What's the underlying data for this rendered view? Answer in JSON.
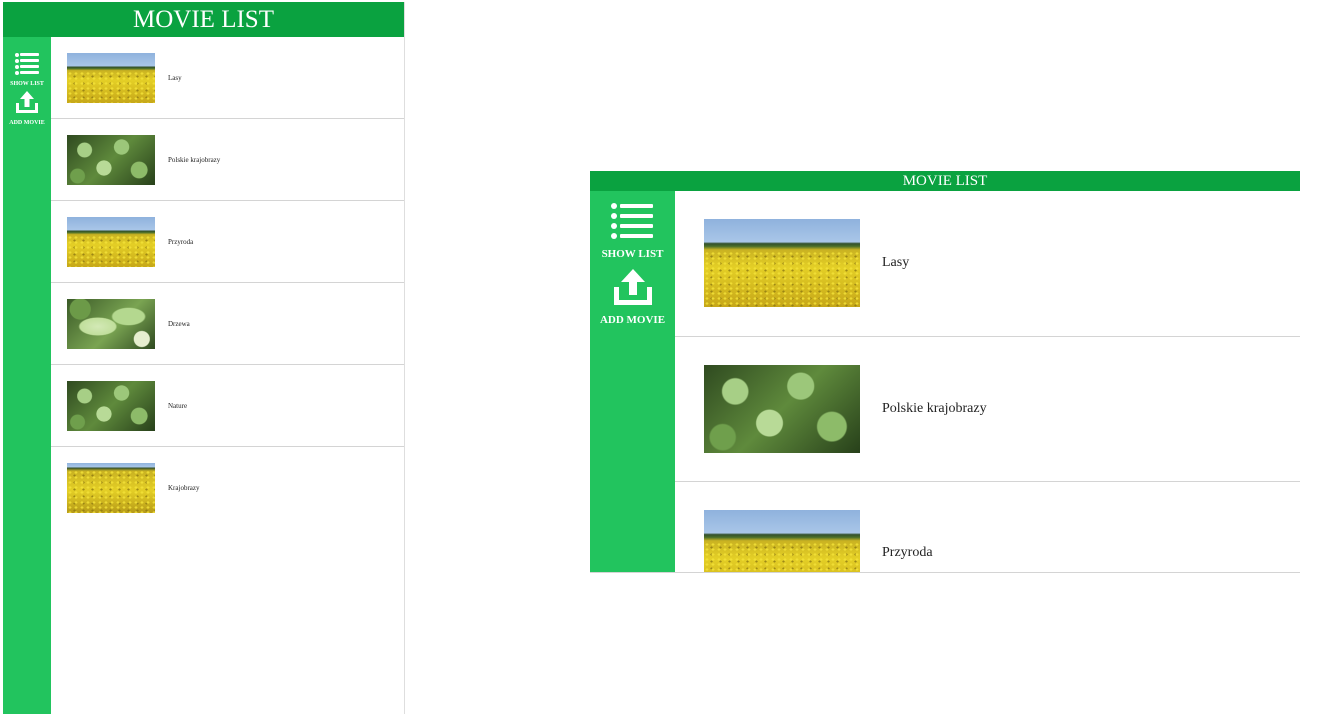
{
  "header": {
    "title": "MOVIE LIST"
  },
  "nav": {
    "show_list": {
      "label": "SHOW LIST",
      "icon": "list-icon"
    },
    "add_movie": {
      "label": "ADD MOVIE",
      "icon": "upload-icon"
    }
  },
  "movies": [
    {
      "title": "Lasy",
      "thumbnail": "rapeseed-field"
    },
    {
      "title": "Polskie krajobrazy",
      "thumbnail": "green-leaves"
    },
    {
      "title": "Przyroda",
      "thumbnail": "rapeseed-field"
    },
    {
      "title": "Drzewa",
      "thumbnail": "green-leaves-closeup"
    },
    {
      "title": "Nature",
      "thumbnail": "green-leaves"
    },
    {
      "title": "Krajobrazy",
      "thumbnail": "rapeseed-field-closeup"
    }
  ],
  "colors": {
    "header_bg": "#0aa240",
    "sidebar_bg": "#22c45e",
    "header_text": "#ffffff",
    "row_divider": "#d4d4d4"
  }
}
